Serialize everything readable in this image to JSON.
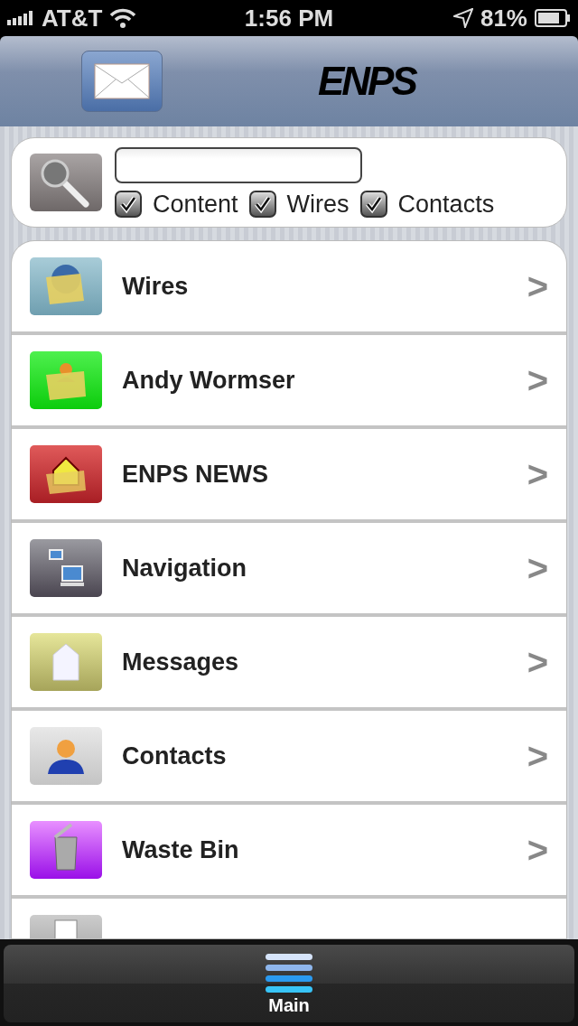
{
  "status_bar": {
    "carrier": "AT&T",
    "time": "1:56 PM",
    "battery": "81%"
  },
  "nav_bar": {
    "title": "ENPS"
  },
  "search": {
    "options": [
      {
        "label": "Content",
        "checked": true
      },
      {
        "label": "Wires",
        "checked": true
      },
      {
        "label": "Contacts",
        "checked": true
      }
    ]
  },
  "menu_items": [
    {
      "label": "Wires",
      "chevron": ">"
    },
    {
      "label": "Andy Wormser",
      "chevron": ">"
    },
    {
      "label": "ENPS NEWS",
      "chevron": ">"
    },
    {
      "label": "Navigation",
      "chevron": ">"
    },
    {
      "label": "Messages",
      "chevron": ">"
    },
    {
      "label": "Contacts",
      "chevron": ">"
    },
    {
      "label": "Waste Bin",
      "chevron": ">"
    }
  ],
  "tab_bar": {
    "tabs": [
      {
        "label": "Main",
        "selected": true
      }
    ]
  }
}
